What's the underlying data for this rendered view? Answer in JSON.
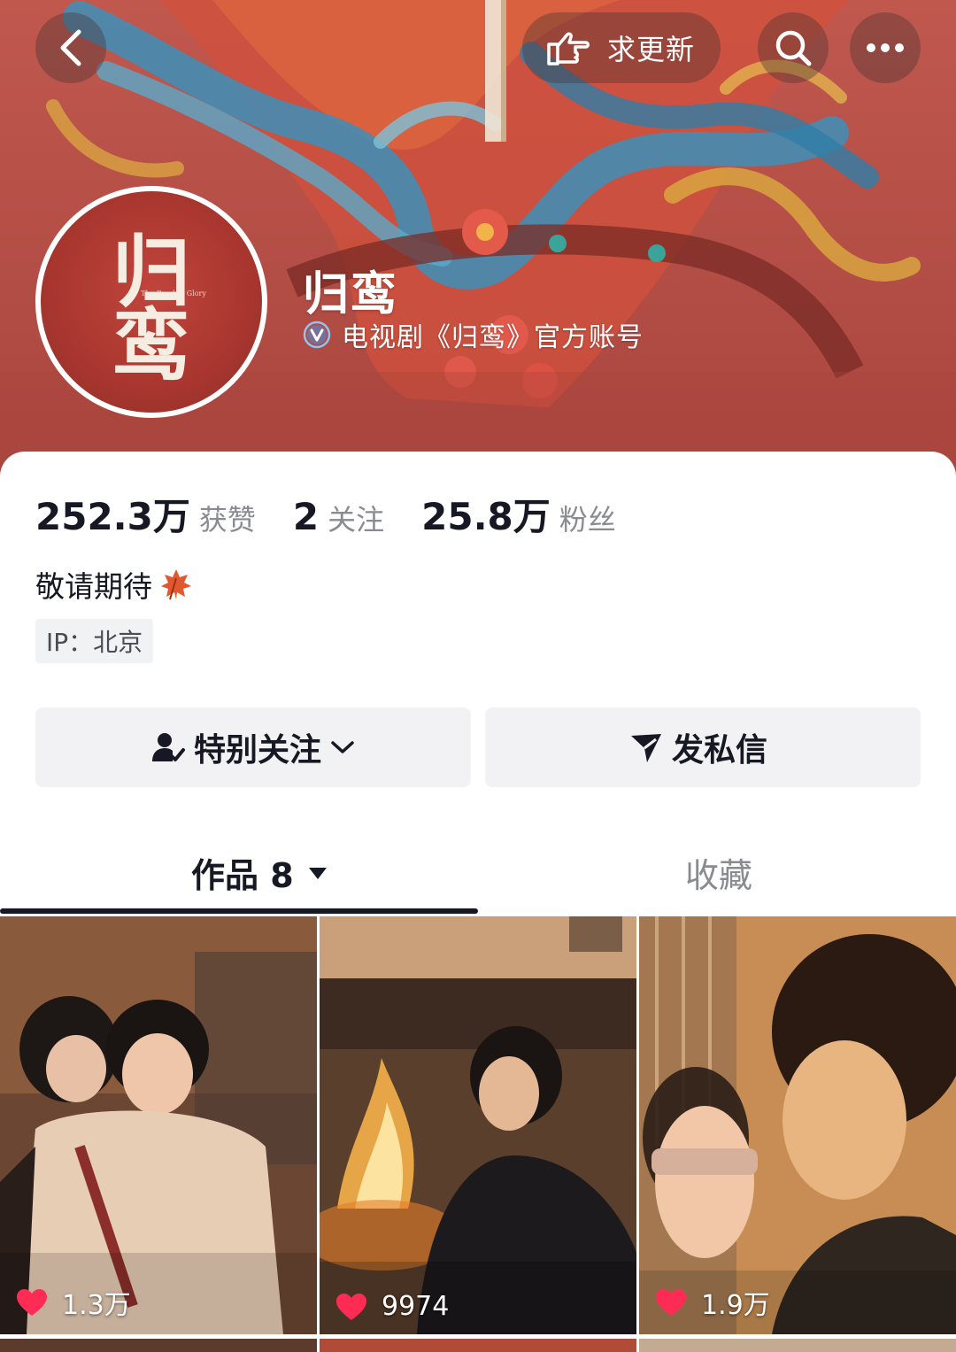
{
  "header": {
    "update_label": "求更新",
    "account_name": "归鸾",
    "verification": "电视剧《归鸾》官方账号",
    "avatar_title": "归鸾",
    "avatar_subtitle": "The Road to Glory"
  },
  "stats": [
    {
      "value": "252.3万",
      "label": "获赞"
    },
    {
      "value": "2",
      "label": "关注"
    },
    {
      "value": "25.8万",
      "label": "粉丝"
    }
  ],
  "bio": "敬请期待",
  "ip_location": "IP：北京",
  "actions": {
    "follow_label": "特别关注",
    "message_label": "发私信"
  },
  "tabs": {
    "works_label": "作品 8",
    "favorites_label": "收藏"
  },
  "videos": [
    {
      "likes": "1.3万"
    },
    {
      "likes": "9974"
    },
    {
      "likes": "1.9万"
    }
  ],
  "colors": {
    "banner": "#b4524a",
    "like_heart": "#fe2c55",
    "text_primary": "#161823",
    "text_secondary": "#8a8b91",
    "button_bg": "#f2f2f4"
  }
}
